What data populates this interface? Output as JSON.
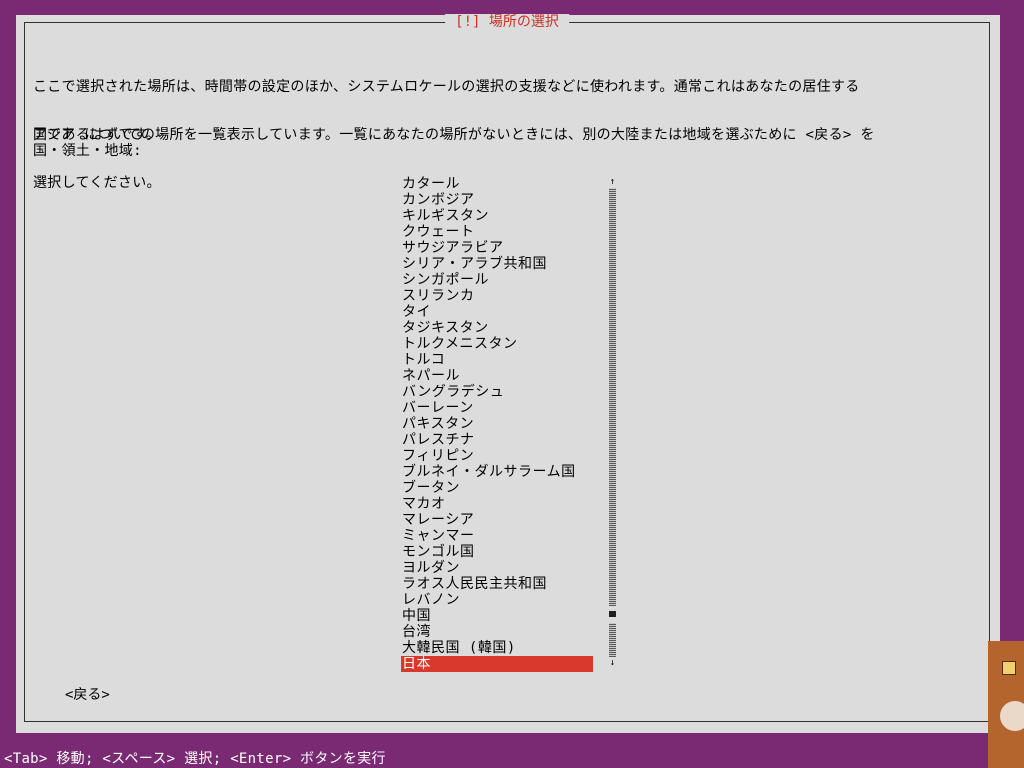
{
  "title": "[!] 場所の選択",
  "description_lines": [
    "ここで選択された場所は、時間帯の設定のほか、システムロケールの選択の支援などに使われます。通常これはあなたの居住する",
    "国であるはずです。"
  ],
  "instruction_lines": [
    "アジア についての場所を一覧表示しています。一覧にあなたの場所がないときには、別の大陸または地域を選ぶために <戻る> を",
    "選択してください。"
  ],
  "list_label": "国・領土・地域:",
  "countries": [
    "カタール",
    "カンボジア",
    "キルギスタン",
    "クウェート",
    "サウジアラビア",
    "シリア・アラブ共和国",
    "シンガポール",
    "スリランカ",
    "タイ",
    "タジキスタン",
    "トルクメニスタン",
    "トルコ",
    "ネパール",
    "バングラデシュ",
    "バーレーン",
    "パキスタン",
    "パレスチナ",
    "フィリピン",
    "ブルネイ・ダルサラーム国",
    "ブータン",
    "マカオ",
    "マレーシア",
    "ミャンマー",
    "モンゴル国",
    "ヨルダン",
    "ラオス人民民主共和国",
    "レバノン",
    "中国",
    "台湾",
    "大韓民国 (韓国)",
    "日本"
  ],
  "selected_index": 30,
  "scrollbar": {
    "up_arrow": "↑",
    "down_arrow": "↓"
  },
  "back_button": "<戻る>",
  "footer": "<Tab> 移動; <スペース> 選択; <Enter> ボタンを実行",
  "colors": {
    "background": "#7a2a73",
    "dialog": "#dcdcdc",
    "title": "#c83228",
    "selection": "#d9382c"
  },
  "icons": [
    "scroll-up-arrow-icon",
    "scroll-down-arrow-icon",
    "taskbar-app-icon"
  ]
}
